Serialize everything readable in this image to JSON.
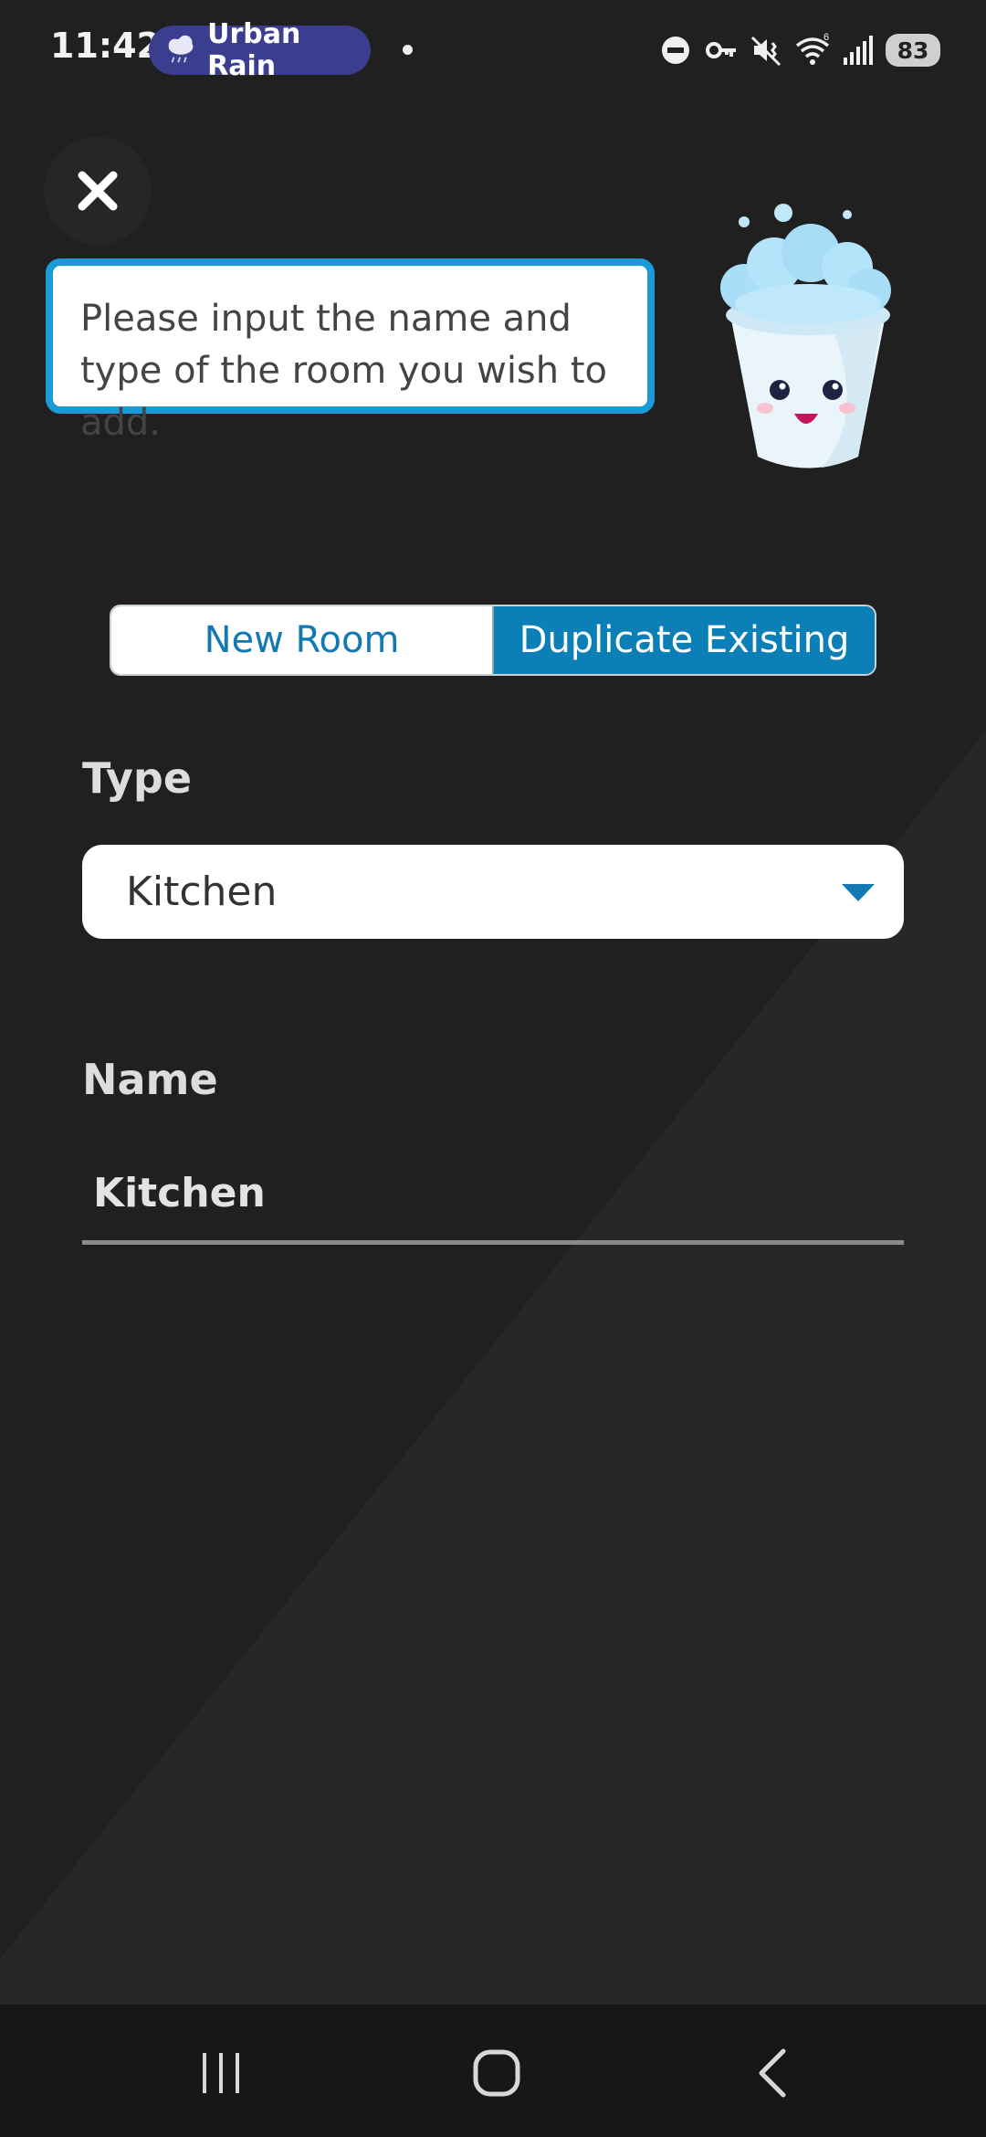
{
  "status_bar": {
    "time": "11:42",
    "notification_pill": "Urban Rain",
    "wifi_badge": "6",
    "battery": "83"
  },
  "bubble": {
    "text": "Please input the name and type of the room you wish to add."
  },
  "segmented": {
    "new_room": "New Room",
    "duplicate_existing": "Duplicate Existing",
    "selected": "duplicate_existing"
  },
  "type_field": {
    "label": "Type",
    "value": "Kitchen"
  },
  "name_field": {
    "label": "Name",
    "value": "Kitchen"
  },
  "colors": {
    "background": "#202020",
    "accent": "#0c7fb6",
    "bubble_border": "#1a9ad6"
  }
}
